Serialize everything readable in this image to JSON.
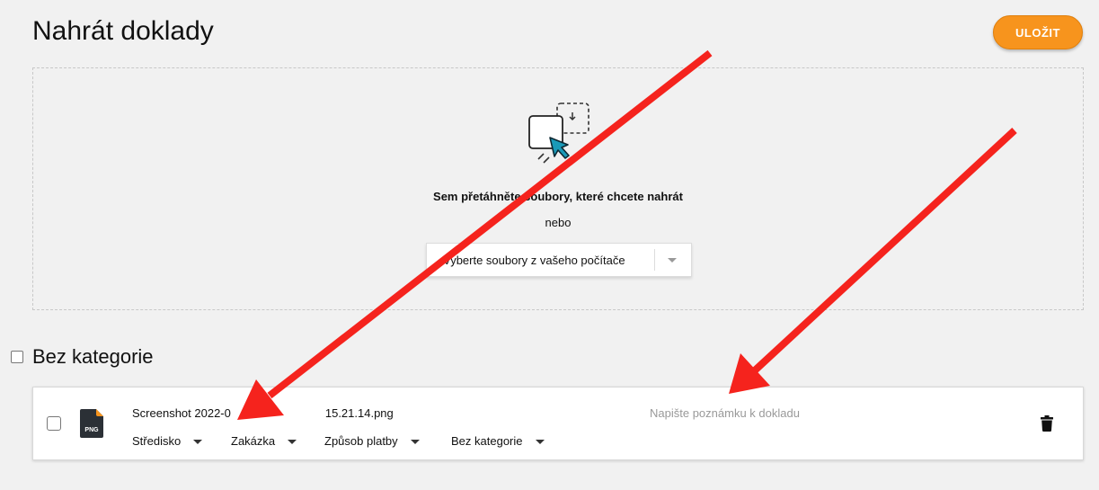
{
  "header": {
    "title": "Nahrát doklady",
    "save_label": "ULOŽIT"
  },
  "dropzone": {
    "icon": "drag-drop-icon",
    "instruction": "Sem přetáhněte soubory, které chcete nahrát",
    "or_label": "nebo",
    "picker_label": "Vyberte soubory z vašeho počítače"
  },
  "category": {
    "title": "Bez kategorie",
    "documents": [
      {
        "file_icon": "png-file-icon",
        "file_type": "PNG",
        "file_name": "Screenshot 2022-0",
        "file_name_tail": "15.21.14.png",
        "note_placeholder": "Napište poznámku k dokladu",
        "selects": [
          {
            "label": "Středisko"
          },
          {
            "label": "Zakázka"
          },
          {
            "label": "Způsob platby"
          },
          {
            "label": "Bez kategorie"
          }
        ],
        "delete_icon": "trash-icon"
      }
    ]
  },
  "colors": {
    "accent": "#f7941d",
    "annotation_arrow": "#f5231d",
    "cursor_blue": "#1a9ab8"
  }
}
